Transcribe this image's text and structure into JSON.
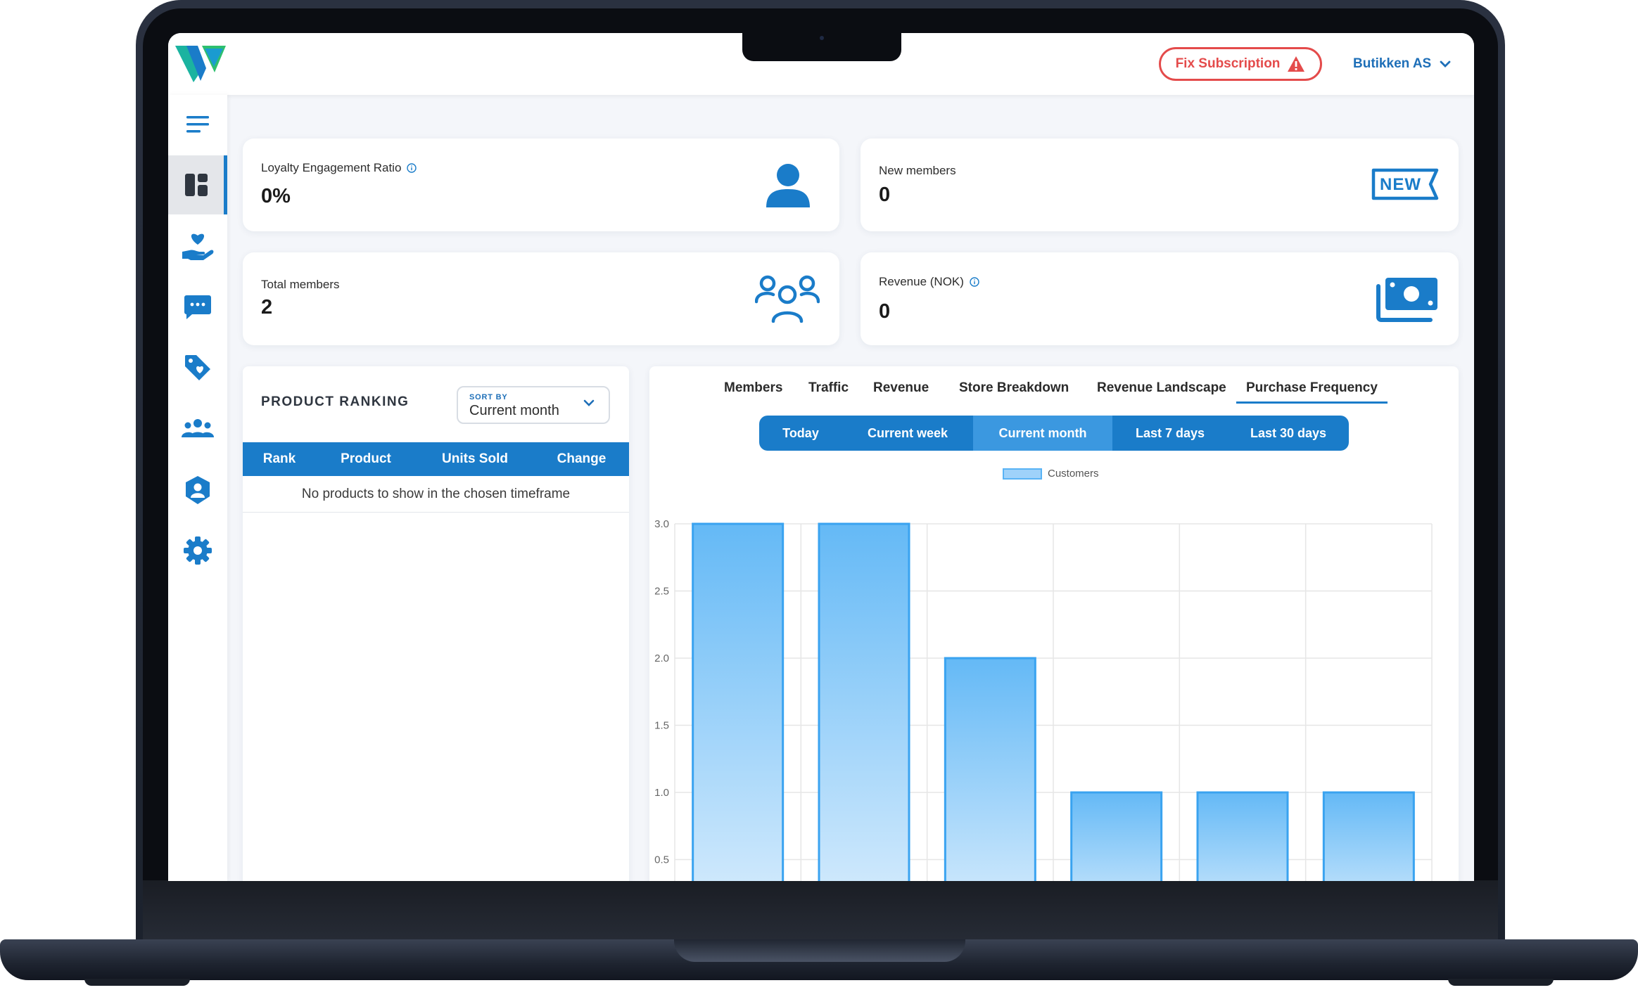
{
  "topbar": {
    "fix_subscription": "Fix Subscription",
    "org_name": "Butikken AS"
  },
  "sidebar": {
    "items": [
      {
        "icon": "menu-icon"
      },
      {
        "icon": "dashboard-icon",
        "active": true
      },
      {
        "icon": "loyalty-heart-hand-icon"
      },
      {
        "icon": "chat-icon"
      },
      {
        "icon": "tag-heart-icon"
      },
      {
        "icon": "members-group-icon"
      },
      {
        "icon": "user-shield-icon"
      },
      {
        "icon": "settings-gear-icon"
      }
    ]
  },
  "stats": {
    "loyalty_label": "Loyalty Engagement Ratio",
    "loyalty_value": "0%",
    "new_members_label": "New members",
    "new_members_value": "0",
    "new_badge": "NEW",
    "total_members_label": "Total members",
    "total_members_value": "2",
    "revenue_label": "Revenue (NOK)",
    "revenue_value": "0"
  },
  "product_ranking": {
    "title": "PRODUCT RANKING",
    "sort_caption": "SORT BY",
    "sort_value": "Current month",
    "columns": [
      "Rank",
      "Product",
      "Units Sold",
      "Change"
    ],
    "empty_message": "No products to show in the chosen timeframe"
  },
  "chart_panel": {
    "tabs": [
      "Members",
      "Traffic",
      "Revenue",
      "Store Breakdown",
      "Revenue Landscape",
      "Purchase Frequency"
    ],
    "active_tab": "Purchase Frequency",
    "periods": [
      "Today",
      "Current week",
      "Current month",
      "Last 7 days",
      "Last 30 days"
    ],
    "active_period": "Current month"
  },
  "colors": {
    "accent": "#1a7cc9",
    "alert": "#e44b4b",
    "bar_fill_top": "#6bbcf6",
    "bar_fill_bottom": "#d6ecfc",
    "bar_stroke": "#3aa3f0"
  },
  "chart_data": {
    "type": "bar",
    "series": [
      {
        "name": "Customers",
        "values": [
          3,
          3,
          2,
          1,
          1,
          1
        ]
      }
    ],
    "y_ticks": [
      "3.0",
      "2.5",
      "2.0",
      "1.5",
      "1.0",
      "0.5"
    ],
    "ylim": [
      0,
      3
    ],
    "grid": true,
    "legend": "top-center"
  }
}
